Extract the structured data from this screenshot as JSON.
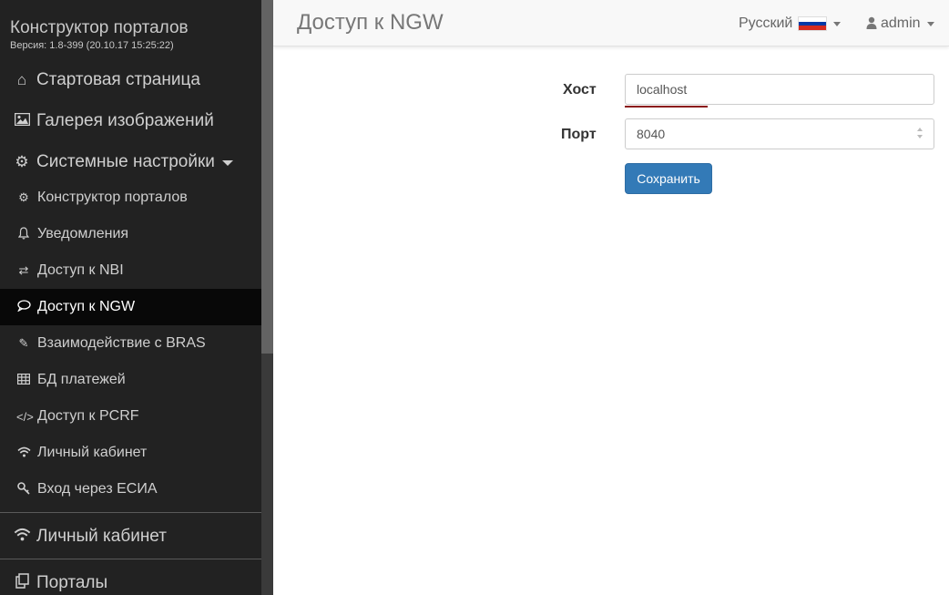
{
  "sidebar": {
    "brand_title": "Конструктор порталов",
    "version": "Версия: 1.8-399 (20.10.17 15:25:22)",
    "items": [
      {
        "label": "Стартовая страница",
        "icon": "home-icon"
      },
      {
        "label": "Галерея изображений",
        "icon": "picture-icon"
      },
      {
        "label": "Системные настройки",
        "icon": "gears-icon"
      },
      {
        "label": "Конструктор порталов",
        "icon": "gear-icon"
      },
      {
        "label": "Уведомления",
        "icon": "bell-icon"
      },
      {
        "label": "Доступ к NBI",
        "icon": "exchange-icon"
      },
      {
        "label": "Доступ к NGW",
        "icon": "comment-icon"
      },
      {
        "label": "Взаимодействие с BRAS",
        "icon": "edit-icon"
      },
      {
        "label": "БД платежей",
        "icon": "table-icon"
      },
      {
        "label": "Доступ к PCRF",
        "icon": "code-icon"
      },
      {
        "label": "Личный кабинет",
        "icon": "wifi-icon"
      },
      {
        "label": "Вход через ЕСИА",
        "icon": "key-icon"
      },
      {
        "label": "Личный кабинет",
        "icon": "wifi-icon"
      },
      {
        "label": "Порталы",
        "icon": "copy-icon"
      }
    ],
    "active_item": "Доступ к NGW"
  },
  "header": {
    "title": "Доступ к NGW",
    "language": "Русский",
    "user": "admin"
  },
  "form": {
    "host_label": "Хост",
    "host_value": "localhost",
    "port_label": "Порт",
    "port_value": "8040",
    "save_label": "Сохранить"
  },
  "colors": {
    "sidebar_bg": "#222222",
    "active_bg": "#080808",
    "primary_button": "#337ab7",
    "flag": [
      "#ffffff",
      "#0039a6",
      "#d52b1e"
    ]
  }
}
